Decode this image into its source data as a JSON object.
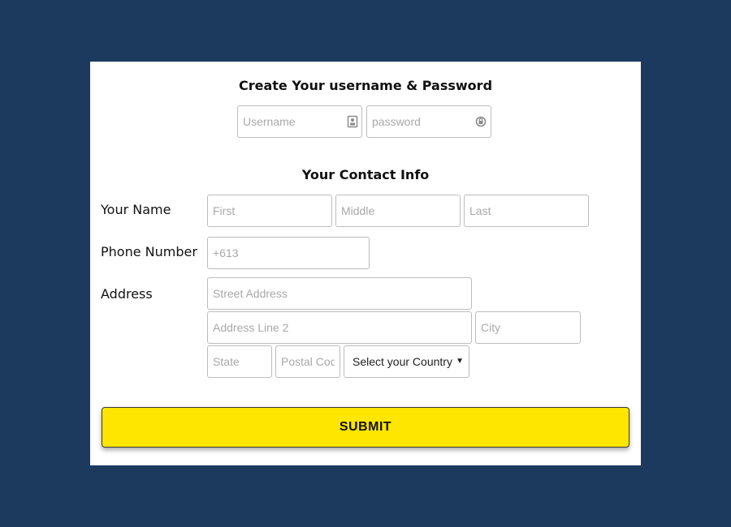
{
  "credentials": {
    "title": "Create Your username & Password",
    "username_placeholder": "Username",
    "password_placeholder": "password",
    "username_icon": "contact-card-icon",
    "password_icon": "lock-refresh-icon"
  },
  "contact": {
    "title": "Your Contact Info",
    "name_label": "Your Name",
    "first_placeholder": "First",
    "middle_placeholder": "Middle",
    "last_placeholder": "Last",
    "phone_label": "Phone Number",
    "phone_placeholder": "+613",
    "address_label": "Address",
    "street_placeholder": "Street Address",
    "line2_placeholder": "Address Line 2",
    "city_placeholder": "City",
    "state_placeholder": "State",
    "postal_placeholder": "Postal Code",
    "country_selected": "Select your Country"
  },
  "submit_label": "SUBMIT",
  "colors": {
    "background": "#1b3a5e",
    "card": "#ffffff",
    "submit": "#ffe600"
  }
}
